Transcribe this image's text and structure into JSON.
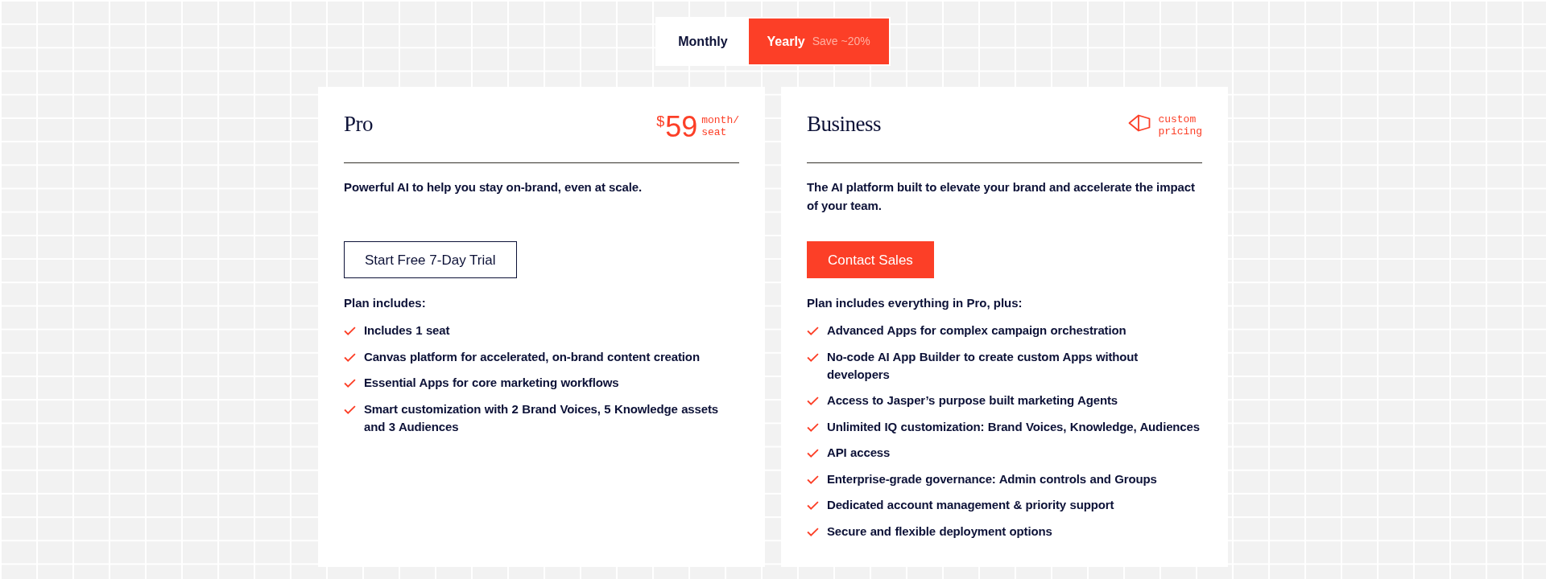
{
  "billing_toggle": [
    {
      "label": "Monthly",
      "selected": false
    },
    {
      "label": "Yearly",
      "note": "Save ~20%",
      "selected": true
    }
  ],
  "plans": [
    {
      "name": "Pro",
      "pricing": {
        "kind": "price",
        "currency": "$",
        "amount": "59",
        "unit": "month/ seat"
      },
      "description": "Powerful AI to help you stay on-brand, even at scale.",
      "button": {
        "kind": "outline",
        "label": "Start Free 7-Day Trial"
      },
      "features_heading": "Plan includes:",
      "features": [
        "Includes 1 seat",
        "Canvas platform for accelerated, on-brand content creation",
        "Essential Apps for core marketing workflows",
        "Smart customization with 2 Brand Voices, 5 Knowledge assets and 3 Audiences"
      ]
    },
    {
      "name": "Business",
      "pricing": {
        "kind": "custom",
        "label": "custom pricing"
      },
      "description": "The AI platform built to elevate your brand and accelerate the impact of your team.",
      "button": {
        "kind": "primary",
        "label": "Contact Sales"
      },
      "features_heading": "Plan includes everything in Pro, plus:",
      "features": [
        "Advanced Apps for complex campaign orchestration",
        "No-code AI App Builder to create custom Apps without developers",
        "Access to Jasper’s purpose built marketing Agents",
        "Unlimited IQ customization: Brand Voices, Knowledge, Audiences",
        "API access",
        "Enterprise-grade governance: Admin controls and Groups",
        "Dedicated account management & priority support",
        "Secure and flexible deployment options"
      ]
    }
  ]
}
